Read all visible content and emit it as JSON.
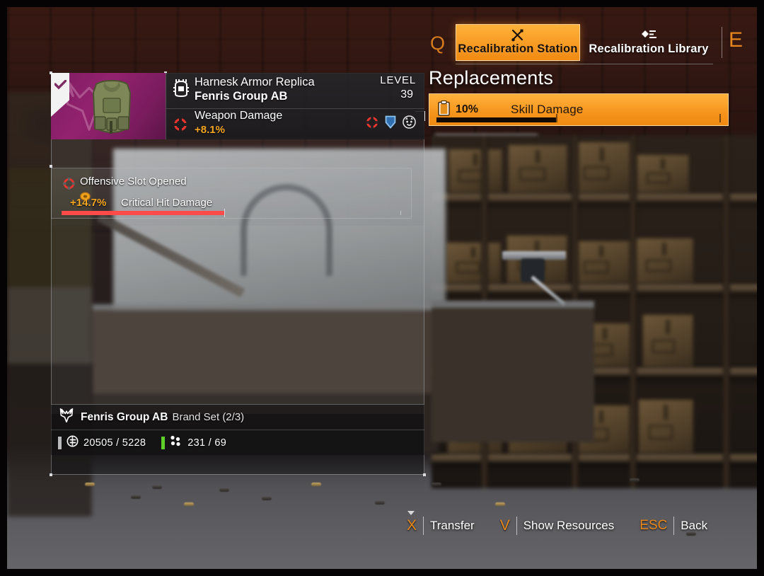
{
  "top_nav": {
    "prev_key": "Q",
    "next_key": "E",
    "tabs": [
      {
        "label": "Recalibration Station",
        "icon": "tools-icon",
        "active": true
      },
      {
        "label": "Recalibration Library",
        "icon": "library-diamond-icon",
        "active": false
      }
    ]
  },
  "replacements": {
    "title": "Replacements",
    "rows": [
      {
        "percent": "10%",
        "name": "Skill Damage",
        "icon": "clipboard-icon",
        "bar_fill_pct": 42
      }
    ]
  },
  "item": {
    "name": "Harnesk Armor Replica",
    "brand": "Fenris Group AB",
    "level_label": "LEVEL",
    "level_value": "39",
    "rarity_color": "#8c2068",
    "equipped": true,
    "type_icon": "body-armor-icon",
    "attribute": {
      "name": "Weapon Damage",
      "value": "+8.1%",
      "icon": "offensive-core-icon"
    },
    "slot_icons": [
      "offensive-core-icon",
      "defensive-shield-icon",
      "utility-brand-icon"
    ],
    "mod": {
      "slot_label": "Offensive Slot Opened",
      "slot_icon": "offensive-core-icon",
      "value": "+14.7%",
      "name": "Critical Hit Damage",
      "value_icon": "coin-icon",
      "bar_fill_pct": 48,
      "bar_color": "#ff4a4a"
    },
    "brand_set": {
      "icon": "fenris-wolf-icon",
      "name": "Fenris Group AB",
      "detail": "Brand Set (2/3)"
    }
  },
  "resources": [
    {
      "icon": "e-credits-icon",
      "text": "20505 / 5228",
      "tag_color": "#b9babc"
    },
    {
      "icon": "components-icon",
      "text": "231 / 69",
      "tag_color": "#5fcf2a"
    }
  ],
  "action_bar": [
    {
      "key": "X",
      "label": "Transfer",
      "has_caret": true
    },
    {
      "key": "V",
      "label": "Show Resources",
      "has_caret": false
    },
    {
      "key": "ESC",
      "label": "Back",
      "has_caret": false
    }
  ]
}
